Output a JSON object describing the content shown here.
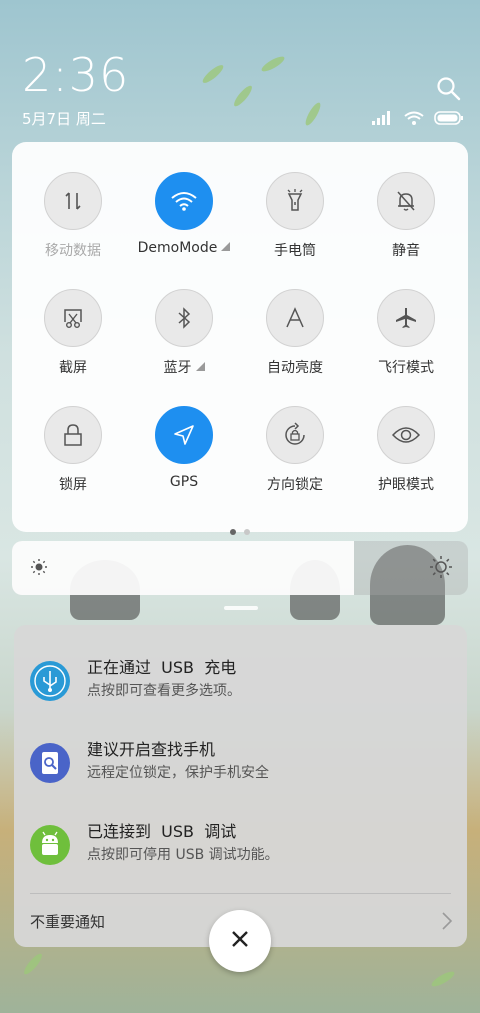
{
  "status_bar": {
    "time": "2:36",
    "date": "5月7日 周二",
    "icons": [
      "signal-icon",
      "wifi-icon",
      "battery-icon"
    ]
  },
  "quick_settings": {
    "tiles": [
      {
        "label": "移动数据",
        "icon": "mobile-data-icon",
        "state": "disabled"
      },
      {
        "label": "DemoMode",
        "icon": "wifi-icon",
        "state": "on",
        "expandable": true
      },
      {
        "label": "手电筒",
        "icon": "flashlight-icon",
        "state": "off"
      },
      {
        "label": "静音",
        "icon": "mute-bell-icon",
        "state": "off"
      },
      {
        "label": "截屏",
        "icon": "screenshot-icon",
        "state": "off"
      },
      {
        "label": "蓝牙",
        "icon": "bluetooth-icon",
        "state": "off",
        "expandable": true
      },
      {
        "label": "自动亮度",
        "icon": "auto-brightness-icon",
        "state": "off"
      },
      {
        "label": "飞行模式",
        "icon": "airplane-icon",
        "state": "off"
      },
      {
        "label": "锁屏",
        "icon": "lock-icon",
        "state": "off"
      },
      {
        "label": "GPS",
        "icon": "location-arrow-icon",
        "state": "on"
      },
      {
        "label": "方向锁定",
        "icon": "rotation-lock-icon",
        "state": "off"
      },
      {
        "label": "护眼模式",
        "icon": "eye-icon",
        "state": "off"
      }
    ],
    "page_count": 2,
    "current_page": 1,
    "accent_color": "#1e8ff0"
  },
  "brightness": {
    "level": 0.75
  },
  "notifications": {
    "items": [
      {
        "title": "正在通过  USB  充电",
        "body": "点按即可查看更多选项。",
        "icon": "usb-icon",
        "color": "#2a9ad6"
      },
      {
        "title": "建议开启查找手机",
        "body": "远程定位锁定，保护手机安全",
        "icon": "find-phone-icon",
        "color": "#4a64c8"
      },
      {
        "title": "已连接到  USB  调试",
        "body": "点按即可停用 USB 调试功能。",
        "icon": "android-icon",
        "color": "#6fbf3c"
      }
    ],
    "footer_label": "不重要通知"
  }
}
